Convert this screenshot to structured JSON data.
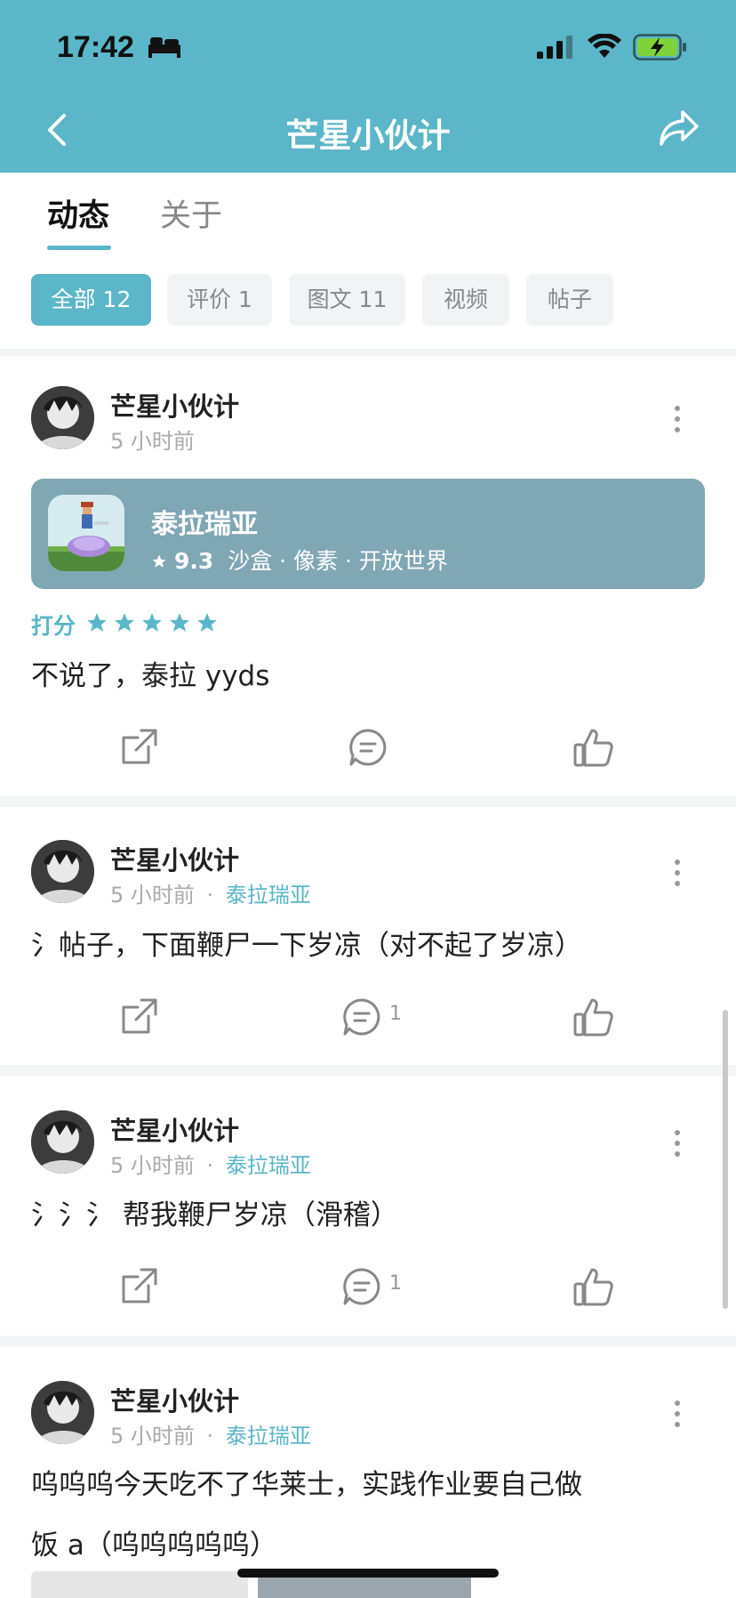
{
  "status": {
    "time": "17:42"
  },
  "nav": {
    "title": "芒星小伙计"
  },
  "tabs": [
    {
      "label": "动态"
    },
    {
      "label": "关于"
    }
  ],
  "filters": [
    {
      "label": "全部 12"
    },
    {
      "label": "评价 1"
    },
    {
      "label": "图文 11"
    },
    {
      "label": "视频"
    },
    {
      "label": "帖子"
    }
  ],
  "colors": {
    "accent": "#5ab6c8",
    "card_bg": "#7fa7b4"
  },
  "posts": [
    {
      "author": "芒星小伙计",
      "time": "5 小时前",
      "game_card": {
        "name": "泰拉瑞亚",
        "score": "9.3",
        "tags": "沙盒 · 像素 · 开放世界"
      },
      "rating_label": "打分",
      "stars": 5,
      "text": "不说了，泰拉 yyds",
      "comment_count": ""
    },
    {
      "author": "芒星小伙计",
      "time": "5 小时前",
      "separator": "·",
      "game": "泰拉瑞亚",
      "text": "氵帖子，下面鞭尸一下岁凉（对不起了岁凉）",
      "comment_count": "1"
    },
    {
      "author": "芒星小伙计",
      "time": "5 小时前",
      "separator": "·",
      "game": "泰拉瑞亚",
      "text": "氵氵氵 帮我鞭尸岁凉（滑稽）",
      "comment_count": "1"
    },
    {
      "author": "芒星小伙计",
      "time": "5 小时前",
      "separator": "·",
      "game": "泰拉瑞亚",
      "text_line1": "呜呜呜今天吃不了华莱士，实践作业要自己做",
      "text_line2": "饭 a（呜呜呜呜呜）"
    }
  ]
}
